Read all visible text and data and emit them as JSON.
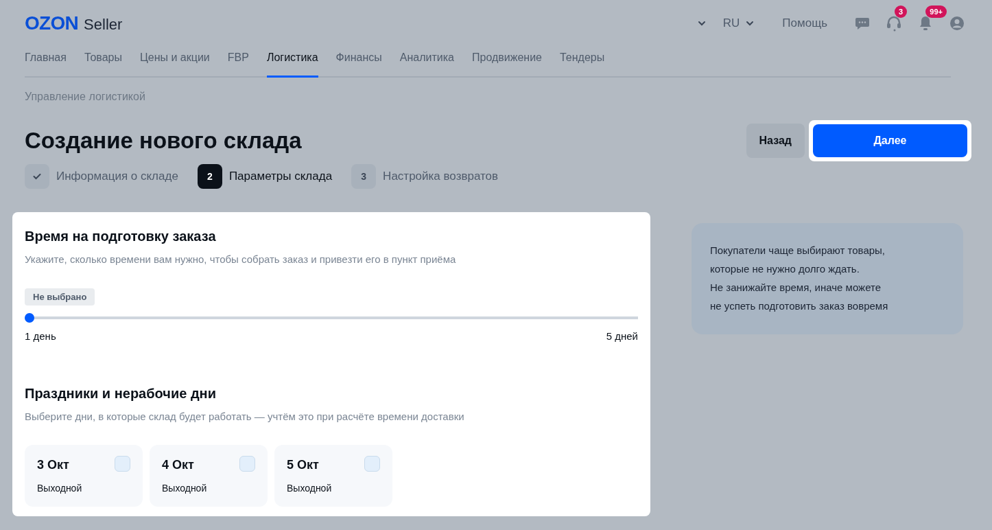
{
  "header": {
    "logo": "OZON",
    "logo_suffix": "Seller",
    "language": "RU",
    "help": "Помощь",
    "support_badge": "3",
    "notifications_badge": "99+"
  },
  "nav": [
    {
      "label": "Главная",
      "selected": false
    },
    {
      "label": "Товары",
      "selected": false
    },
    {
      "label": "Цены и акции",
      "selected": false
    },
    {
      "label": "FBP",
      "selected": false
    },
    {
      "label": "Логистика",
      "selected": true
    },
    {
      "label": "Финансы",
      "selected": false
    },
    {
      "label": "Аналитика",
      "selected": false
    },
    {
      "label": "Продвижение",
      "selected": false
    },
    {
      "label": "Тендеры",
      "selected": false
    }
  ],
  "breadcrumb": "Управление логистикой",
  "title": "Создание нового склада",
  "buttons": {
    "back": "Назад",
    "next": "Далее"
  },
  "steps": [
    {
      "kind": "done",
      "label": "Информация о складе"
    },
    {
      "kind": "current",
      "number": "2",
      "label": "Параметры склада"
    },
    {
      "kind": "pending",
      "number": "3",
      "label": "Настройка возвратов"
    }
  ],
  "prep_time": {
    "title": "Время на подготовку заказа",
    "subtitle": "Укажите, сколько времени вам нужно, чтобы собрать заказ и привезти его в пункт приёма",
    "value_chip": "Не выбрано",
    "slider": {
      "level": 0,
      "min_label": "1 день",
      "max_label": "5 дней"
    }
  },
  "holidays": {
    "title": "Праздники и нерабочие дни",
    "subtitle": "Выберите дни, в которые склад будет работать — учтём это при расчёте времени доставки",
    "days": [
      {
        "date": "3 Окт",
        "note": "Выходной",
        "checked": false
      },
      {
        "date": "4 Окт",
        "note": "Выходной",
        "checked": false
      },
      {
        "date": "5 Окт",
        "note": "Выходной",
        "checked": false
      }
    ]
  },
  "tip": [
    "Покупатели чаще выбирают товары,",
    "которые не нужно долго ждать.",
    "Не занижайте время, иначе можете",
    "не успеть подготовить заказ вовремя"
  ]
}
